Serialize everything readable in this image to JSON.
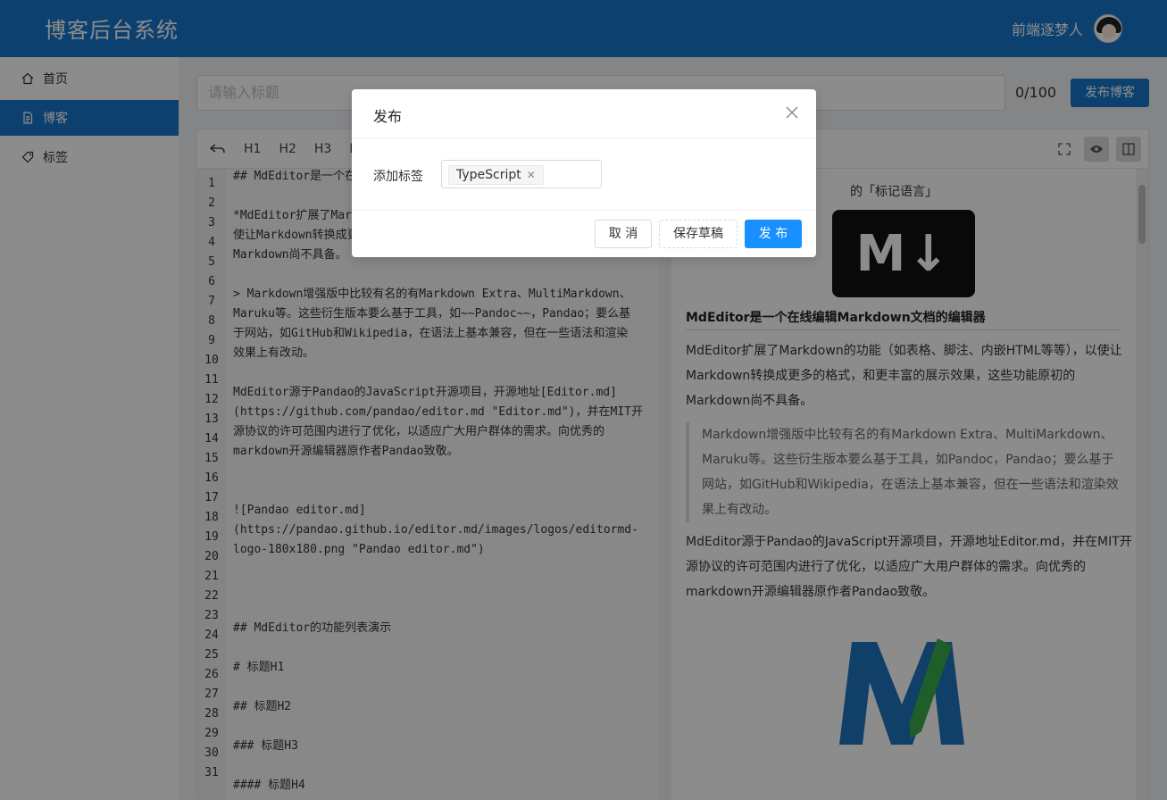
{
  "header": {
    "title": "博客后台系统",
    "user_name": "前端逐梦人"
  },
  "sidebar": {
    "items": [
      {
        "label": "首页",
        "icon": "home-icon"
      },
      {
        "label": "博客",
        "icon": "document-icon"
      },
      {
        "label": "标签",
        "icon": "tag-icon"
      }
    ]
  },
  "title_input": {
    "placeholder": "请输入标题",
    "counter": "0/100"
  },
  "publish_button": "发布博客",
  "toolbar": {
    "items": [
      "H1",
      "H2",
      "H3",
      "H"
    ]
  },
  "code": {
    "lines": [
      "## MdEditor是一个在线编辑Markdown文档的编辑器",
      "",
      "*MdEditor扩展了Markdown的功能（如表格、脚注、内嵌HTML等等），以",
      "使让Markdown转换成更多的格式，和更丰富的展示效果，这些功能原初的",
      "Markdown尚不具备。",
      "",
      "> Markdown增强版中比较有名的有Markdown Extra、MultiMarkdown、",
      "Maruku等。这些衍生版本要么基于工具，如~~Pandoc~~，Pandao；要么基",
      "于网站，如GitHub和Wikipedia，在语法上基本兼容，但在一些语法和渲染",
      "效果上有改动。",
      "",
      "MdEditor源于Pandao的JavaScript开源项目，开源地址[Editor.md]",
      "(https://github.com/pandao/editor.md \"Editor.md\")，并在MIT开",
      "源协议的许可范围内进行了优化，以适应广大用户群体的需求。向优秀的",
      "markdown开源编辑器原作者Pandao致敬。",
      "",
      "",
      "![Pandao editor.md]",
      "(https://pandao.github.io/editor.md/images/logos/editormd-",
      "logo-180x180.png \"Pandao editor.md\")",
      "",
      "",
      "",
      "## MdEditor的功能列表演示",
      "",
      "# 标题H1",
      "",
      "## 标题H2",
      "",
      "### 标题H3",
      "",
      "#### 标题H4"
    ],
    "line_numbers": [
      "1",
      "2",
      "3",
      "4",
      "5",
      "6",
      "7",
      "8",
      "9",
      "10",
      "11",
      "12",
      "13",
      "14",
      "15",
      "16",
      "17",
      "18",
      "19",
      "20",
      "21",
      "22",
      "23",
      "24",
      "25",
      "26",
      "27",
      "28",
      "29",
      "30",
      "31"
    ]
  },
  "preview": {
    "top_text": "的「标记语言」",
    "logo_text": "M↓",
    "heading": "MdEditor是一个在线编辑Markdown文档的编辑器",
    "para1": [
      "MdEditor扩展了Markdown的功能（如表格、脚注、内嵌HTML等等），以使让",
      "Markdown转换成更多的格式，和更丰富的展示效果，这些功能原初的",
      "Markdown尚不具备。"
    ],
    "quote": [
      "Markdown增强版中比较有名的有Markdown Extra、MultiMarkdown、",
      "Maruku等。这些衍生版本要么基于工具，如Pandoc，Pandao；要么基于",
      "网站，如GitHub和Wikipedia，在语法上基本兼容，但在一些语法和渲染效",
      "果上有改动。"
    ],
    "para2": [
      "MdEditor源于Pandao的JavaScript开源项目，开源地址Editor.md，并在MIT开",
      "源协议的许可范围内进行了优化，以适应广大用户群体的需求。向优秀的",
      "markdown开源编辑器原作者Pandao致敬。"
    ]
  },
  "modal": {
    "title": "发布",
    "tag_label": "添加标签",
    "tags": [
      "TypeScript"
    ],
    "cancel": "取 消",
    "draft": "保存草稿",
    "publish": "发 布"
  },
  "colors": {
    "brand": "#1677cb",
    "primary": "#1890ff"
  }
}
